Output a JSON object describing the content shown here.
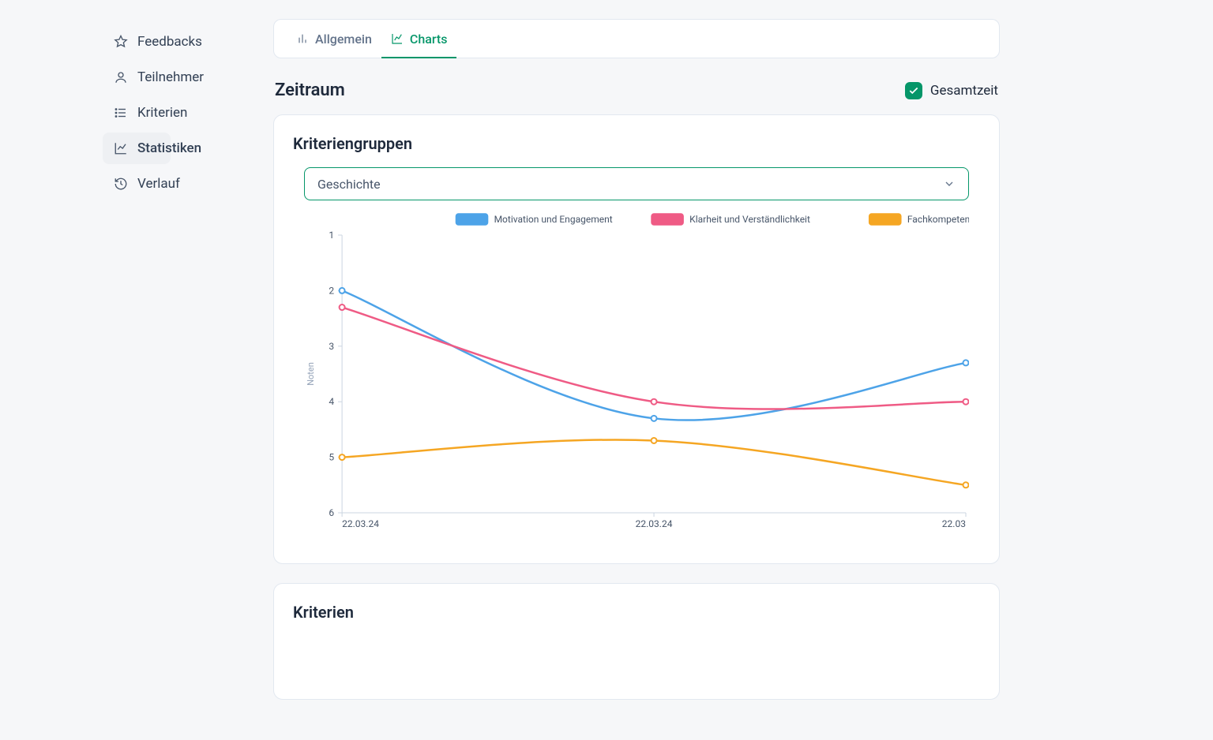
{
  "sidebar": {
    "items": [
      {
        "label": "Feedbacks",
        "icon": "star"
      },
      {
        "label": "Teilnehmer",
        "icon": "user"
      },
      {
        "label": "Kriterien",
        "icon": "list"
      },
      {
        "label": "Statistiken",
        "icon": "chart",
        "active": true
      },
      {
        "label": "Verlauf",
        "icon": "history"
      }
    ]
  },
  "tabs": [
    {
      "label": "Allgemein",
      "icon": "bar-chart"
    },
    {
      "label": "Charts",
      "icon": "line-chart",
      "active": true
    }
  ],
  "zeitraum": {
    "title": "Zeitraum",
    "checkbox_label": "Gesamtzeit",
    "checkbox_checked": true
  },
  "card1": {
    "title": "Kriteriengruppen",
    "select_value": "Geschichte"
  },
  "card2": {
    "title": "Kriterien"
  },
  "chart_data": {
    "type": "line",
    "ylabel": "Noten",
    "ylim": [
      1,
      6
    ],
    "y_inverted": true,
    "categories": [
      "22.03.24",
      "22.03.24",
      "22.03"
    ],
    "series": [
      {
        "name": "Motivation und Engagement",
        "color": "#4da3e8",
        "values": [
          2.0,
          4.3,
          3.3
        ]
      },
      {
        "name": "Klarheit und Verständlichkeit",
        "color": "#ef5b85",
        "values": [
          2.3,
          4.0,
          4.0
        ]
      },
      {
        "name": "Fachkompetenz",
        "color": "#f5a623",
        "values": [
          5.0,
          4.7,
          5.5
        ]
      }
    ]
  }
}
